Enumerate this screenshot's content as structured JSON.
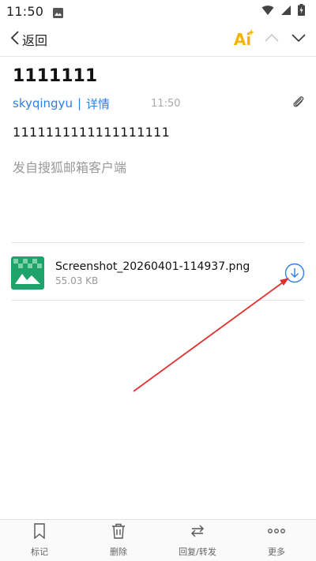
{
  "status_bar": {
    "time": "11:50"
  },
  "top_bar": {
    "back_label": "返回",
    "ai_label": "Ai"
  },
  "email": {
    "subject": "1111111",
    "sender": "skyqingyu",
    "separator": "|",
    "detail_label": "详情",
    "time": "11:50",
    "body": "1111111111111111111",
    "signature": "发自搜狐邮箱客户端"
  },
  "attachment": {
    "name": "Screenshot_20260401-114937.png",
    "size": "55.03 KB"
  },
  "toolbar": {
    "mark_label": "标记",
    "delete_label": "删除",
    "reply_forward_label": "回复/转发",
    "more_label": "更多"
  },
  "colors": {
    "accent": "#2e7ee6",
    "ai": "#f5b400",
    "thumb_green": "#1ea36a",
    "annotation_arrow": "#e03131"
  }
}
